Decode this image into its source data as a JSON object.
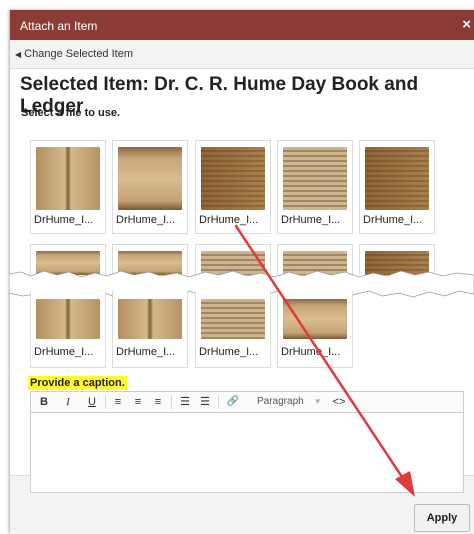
{
  "dialog": {
    "title": "Attach an Item",
    "close_glyph": "×",
    "back_link": "Change Selected Item",
    "heading": "Selected Item: Dr. C. R. Hume Day Book and Ledger",
    "instruction": "Select a file to use."
  },
  "thumbnails": [
    {
      "label": "DrHume_I..."
    },
    {
      "label": "DrHume_I..."
    },
    {
      "label": "DrHume_I..."
    },
    {
      "label": "DrHume_I..."
    },
    {
      "label": "DrHume_I..."
    },
    {
      "label": "DrHume_I..."
    },
    {
      "label": "DrHume_I..."
    },
    {
      "label": "DrHume_I..."
    },
    {
      "label": "DrHume_I..."
    }
  ],
  "caption": {
    "label": "Provide a caption.",
    "toolbar": {
      "bold": "B",
      "italic": "I",
      "underline": "U",
      "align_left": "≡",
      "align_center": "≡",
      "align_right": "≡",
      "bullet_list": "☰",
      "numbered_list": "☰",
      "link": "🔗",
      "format": "Paragraph",
      "code": "<>"
    }
  },
  "footer": {
    "apply_label": "Apply"
  },
  "colors": {
    "titlebar": "#8b3c36",
    "highlight": "#fffb2c",
    "arrow": "#e03a3a"
  }
}
